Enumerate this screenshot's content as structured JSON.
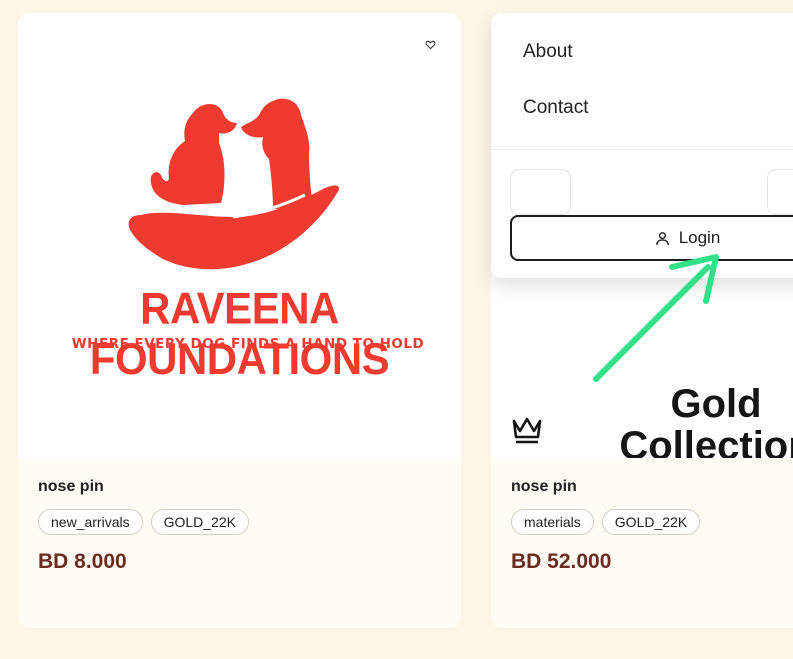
{
  "products": [
    {
      "name": "nose pin",
      "tags": [
        "new_arrivals",
        "GOLD_22K"
      ],
      "price": "BD 8.000",
      "image": {
        "brand": "RAVEENA FOUNDATIONS",
        "tagline": "WHERE EVERY DOG FINDS A HAND TO HOLD"
      }
    },
    {
      "name": "nose pin",
      "tags": [
        "materials",
        "GOLD_22K"
      ],
      "price": "BD 52.000",
      "image": {
        "heading": "Gold Collection"
      }
    }
  ],
  "menu": {
    "items": [
      {
        "label": "About"
      },
      {
        "label": "Contact"
      }
    ],
    "login_label": "Login"
  },
  "icons": {
    "favorite": "heart-icon",
    "user": "user-icon",
    "crown": "crown-icon",
    "annotation": "arrow-annotation"
  },
  "colors": {
    "background": "#fdf6e6",
    "price": "#6a2b20",
    "brand_red": "#ee3a2f",
    "arrow": "#33e08a"
  }
}
